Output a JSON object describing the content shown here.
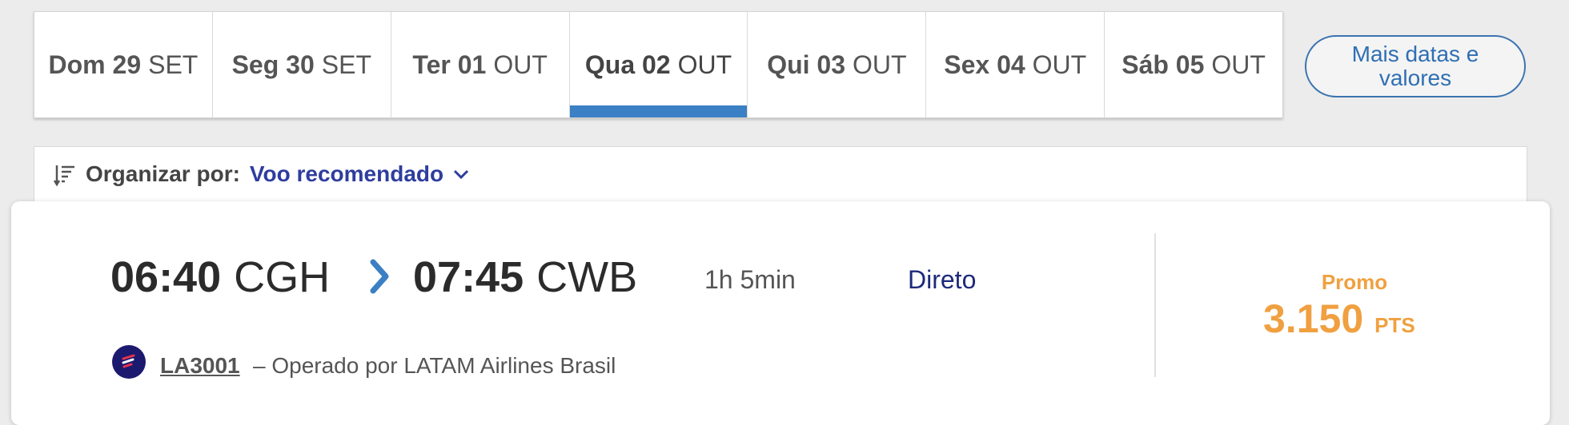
{
  "date_tabs": [
    {
      "day": "Dom 29",
      "month": "SET",
      "active": false
    },
    {
      "day": "Seg 30",
      "month": "SET",
      "active": false
    },
    {
      "day": "Ter 01",
      "month": "OUT",
      "active": false
    },
    {
      "day": "Qua 02",
      "month": "OUT",
      "active": true
    },
    {
      "day": "Qui 03",
      "month": "OUT",
      "active": false
    },
    {
      "day": "Sex 04",
      "month": "OUT",
      "active": false
    },
    {
      "day": "Sáb 05",
      "month": "OUT",
      "active": false
    }
  ],
  "more_dates_label": "Mais datas e valores",
  "sort": {
    "label": "Organizar por:",
    "value": "Voo recomendado",
    "icon": "sort-lines-icon",
    "dropdown_icon": "chevron-down-icon"
  },
  "flight": {
    "departure_time": "06:40",
    "departure_airport": "CGH",
    "arrival_time": "07:45",
    "arrival_airport": "CWB",
    "duration": "1h 5min",
    "stops": "Direto",
    "flight_number": "LA3001",
    "operated_by": "– Operado por LATAM Airlines Brasil",
    "fare_label": "Promo",
    "points": "3.150",
    "points_unit": "PTS",
    "airline_logo_icon": "latam-logo-icon",
    "route_arrow_icon": "chevron-right-icon"
  },
  "colors": {
    "accent_blue": "#3b7fc4",
    "sort_value": "#2e3d9e",
    "stops_text": "#1e2a7a",
    "price_orange": "#f0a040",
    "page_background": "#ececec"
  }
}
